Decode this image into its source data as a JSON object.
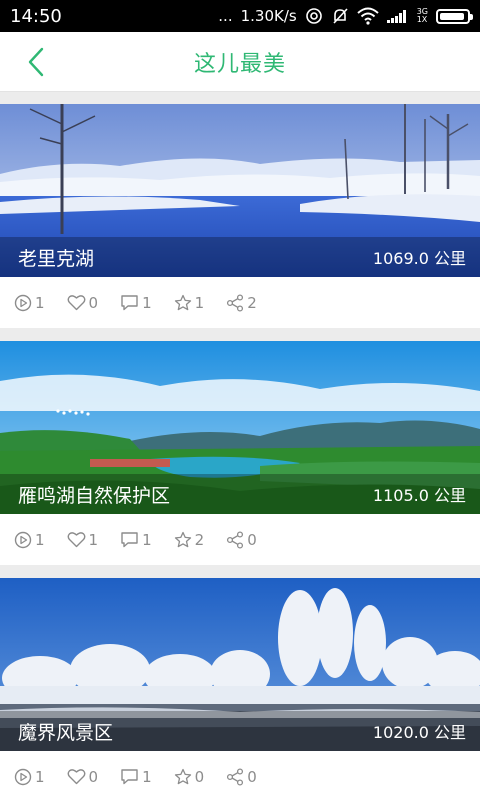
{
  "status_bar": {
    "time": "14:50",
    "dots": "...",
    "net_speed": "1.30K/s",
    "net_type_top": "3G",
    "net_type_bottom": "1X"
  },
  "header": {
    "title": "这儿最美",
    "accent_color": "#2fb874"
  },
  "cards": [
    {
      "name": "老里克湖",
      "distance": "1069.0 公里",
      "plays": "1",
      "likes": "0",
      "comments": "1",
      "favorites": "1",
      "shares": "2"
    },
    {
      "name": "雁鸣湖自然保护区",
      "distance": "1105.0 公里",
      "plays": "1",
      "likes": "1",
      "comments": "1",
      "favorites": "2",
      "shares": "0"
    },
    {
      "name": "魔界风景区",
      "distance": "1020.0 公里",
      "plays": "1",
      "likes": "0",
      "comments": "1",
      "favorites": "0",
      "shares": "0"
    }
  ],
  "icons": {
    "play": "play-circle-icon",
    "like": "heart-icon",
    "comment": "comment-bubble-icon",
    "favorite": "star-icon",
    "share": "share-icon",
    "back": "chevron-left-icon"
  }
}
